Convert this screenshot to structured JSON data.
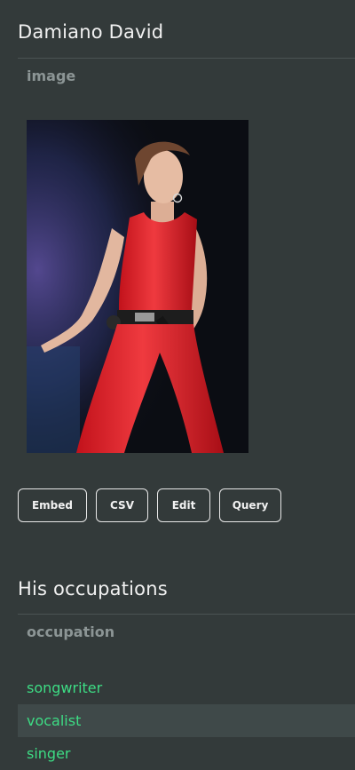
{
  "entity": {
    "title": "Damiano David",
    "image_field_label": "image"
  },
  "actions": {
    "embed": "Embed",
    "csv": "CSV",
    "edit": "Edit",
    "query": "Query"
  },
  "occupations": {
    "title": "His occupations",
    "column_label": "occupation",
    "items": [
      "songwriter",
      "vocalist",
      "singer"
    ]
  },
  "colors": {
    "background": "#333a3a",
    "link": "#3ddc84",
    "muted_label": "#8c9595",
    "row_highlight": "#3f4949"
  }
}
